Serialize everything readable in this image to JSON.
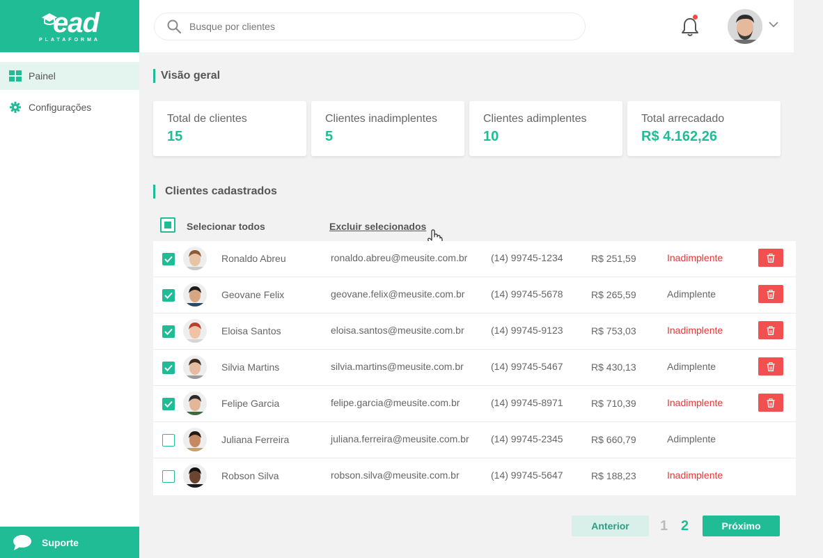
{
  "brand": {
    "name": "ead",
    "tagline": "PLATAFORMA"
  },
  "sidebar": {
    "items": [
      {
        "label": "Painel",
        "icon": "dashboard-icon"
      },
      {
        "label": "Configurações",
        "icon": "gear-icon"
      }
    ],
    "support_label": "Suporte"
  },
  "header": {
    "search_placeholder": "Busque por clientes",
    "has_notification": true
  },
  "overview": {
    "title": "Visão geral",
    "cards": [
      {
        "label": "Total de clientes",
        "value": "15"
      },
      {
        "label": "Clientes inadimplentes",
        "value": "5"
      },
      {
        "label": "Clientes adimplentes",
        "value": "10"
      },
      {
        "label": "Total arrecadado",
        "value": "R$ 4.162,26"
      }
    ]
  },
  "clients": {
    "title": "Clientes cadastrados",
    "select_all_label": "Selecionar todos",
    "delete_selected_label": "Excluir selecionados",
    "rows": [
      {
        "name": "Ronaldo Abreu",
        "email": "ronaldo.abreu@meusite.com.br",
        "phone": "(14) 99745-1234",
        "amount": "R$ 251,59",
        "status": "Inadimplente",
        "checked": true
      },
      {
        "name": "Geovane Felix",
        "email": "geovane.felix@meusite.com.br",
        "phone": "(14) 99745-5678",
        "amount": "R$ 265,59",
        "status": "Adimplente",
        "checked": true
      },
      {
        "name": "Eloisa Santos",
        "email": "eloisa.santos@meusite.com.br",
        "phone": "(14) 99745-9123",
        "amount": "R$ 753,03",
        "status": "Inadimplente",
        "checked": true
      },
      {
        "name": "Silvia Martins",
        "email": "silvia.martins@meusite.com.br",
        "phone": "(14) 99745-5467",
        "amount": "R$ 430,13",
        "status": "Adimplente",
        "checked": true
      },
      {
        "name": "Felipe Garcia",
        "email": "felipe.garcia@meusite.com.br",
        "phone": "(14) 99745-8971",
        "amount": "R$ 710,39",
        "status": "Inadimplente",
        "checked": true
      },
      {
        "name": "Juliana Ferreira",
        "email": "juliana.ferreira@meusite.com.br",
        "phone": "(14) 99745-2345",
        "amount": "R$ 660,79",
        "status": "Adimplente",
        "checked": false
      },
      {
        "name": "Robson Silva",
        "email": "robson.silva@meusite.com.br",
        "phone": "(14) 99745-5647",
        "amount": "R$ 188,23",
        "status": "Inadimplente",
        "checked": false
      }
    ]
  },
  "pagination": {
    "prev_label": "Anterior",
    "pages": [
      "1",
      "2"
    ],
    "current_page": "2",
    "next_label": "Próximo"
  },
  "colors": {
    "accent": "#1fbc96",
    "danger": "#f25050",
    "status_bad": "#e33333"
  }
}
